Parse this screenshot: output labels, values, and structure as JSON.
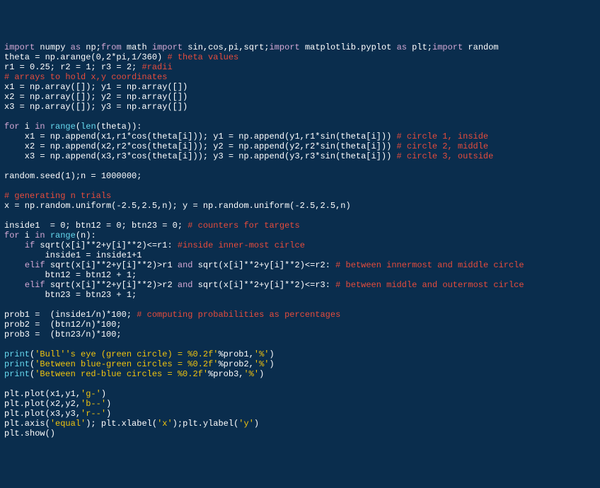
{
  "code": {
    "line1": {
      "import1": "import",
      "numpy": " numpy ",
      "as1": "as",
      "np": " np;",
      "from1": "from",
      "math": " math ",
      "import2": "import",
      "funcs": " sin,cos,pi,sqrt;",
      "import3": "import",
      "mpl": " matplotlib.pyplot ",
      "as2": "as",
      "plt": " plt;",
      "import4": "import",
      "random": " random"
    },
    "line2": {
      "text": "theta = np.arange(0,2*pi,1/360) ",
      "comment": "# theta values"
    },
    "line3": {
      "text": "r1 = 0.25; r2 = 1; r3 = 2; ",
      "comment": "#radii"
    },
    "line4": {
      "comment": "# arrays to hold x,y coordinates"
    },
    "line5": {
      "text": "x1 = np.array([]); y1 = np.array([])"
    },
    "line6": {
      "text": "x2 = np.array([]); y2 = np.array([])"
    },
    "line7": {
      "text": "x3 = np.array([]); y3 = np.array([])"
    },
    "line9": {
      "for": "for",
      "i": " i ",
      "in": "in",
      "range": " range",
      "len": "len",
      "text": "(theta)):"
    },
    "line10": {
      "text": "    x1 = np.append(x1,r1*cos(theta[i])); y1 = np.append(y1,r1*sin(theta[i])) ",
      "comment": "# circle 1, inside"
    },
    "line11": {
      "text": "    x2 = np.append(x2,r2*cos(theta[i])); y2 = np.append(y2,r2*sin(theta[i])) ",
      "comment": "# circle 2, middle"
    },
    "line12": {
      "text": "    x3 = np.append(x3,r3*cos(theta[i])); y3 = np.append(y3,r3*sin(theta[i])) ",
      "comment": "# circle 3, outside"
    },
    "line14": {
      "text": "random.seed(1);n = 1000000;"
    },
    "line16": {
      "comment": "# generating n trials"
    },
    "line17": {
      "text": "x = np.random.uniform(-2.5,2.5,n); y = np.random.uniform(-2.5,2.5,n)"
    },
    "line19": {
      "text": "inside1  = 0; btn12 = 0; btn23 = 0; ",
      "comment": "# counters for targets"
    },
    "line20": {
      "for": "for",
      "i": " i ",
      "in": "in",
      "range": " range",
      "text": "(n):"
    },
    "line21": {
      "indent": "    ",
      "if": "if",
      "sqrt": " sqrt",
      "text": "(x[i]**2+y[i]**2)<=r1: ",
      "comment": "#inside inner-most cirlce"
    },
    "line22": {
      "text": "        inside1 = inside1+1"
    },
    "line23": {
      "indent": "    ",
      "elif": "elif",
      "sqrt1": " sqrt",
      "text1": "(x[i]**2+y[i]**2)>r1 ",
      "and": "and",
      "sqrt2": " sqrt",
      "text2": "(x[i]**2+y[i]**2)<=r2: ",
      "comment": "# between innermost and middle circle"
    },
    "line24": {
      "text": "        btn12 = btn12 + 1;"
    },
    "line25": {
      "indent": "    ",
      "elif": "elif",
      "sqrt1": " sqrt",
      "text1": "(x[i]**2+y[i]**2)>r2 ",
      "and": "and",
      "sqrt2": " sqrt",
      "text2": "(x[i]**2+y[i]**2)<=r3: ",
      "comment": "# between middle and outermost cirlce"
    },
    "line26": {
      "text": "        btn23 = btn23 + 1;"
    },
    "line28": {
      "text": "prob1 =  (inside1/n)*100; ",
      "comment": "# computing probabilities as percentages"
    },
    "line29": {
      "text": "prob2 =  (btn12/n)*100;"
    },
    "line30": {
      "text": "prob3 =  (btn23/n)*100;"
    },
    "line32": {
      "print": "print",
      "paren1": "(",
      "str1": "'Bull'",
      "str2": "'s eye (green circle) = %0.2f'",
      "mid": "%prob1,",
      "str3": "'%'",
      "paren2": ")"
    },
    "line33": {
      "print": "print",
      "paren1": "(",
      "str1": "'Between blue-green circles = %0.2f'",
      "mid": "%prob2,",
      "str2": "'%'",
      "paren2": ")"
    },
    "line34": {
      "print": "print",
      "paren1": "(",
      "str1": "'Between red-blue circles = %0.2f'",
      "mid": "%prob3,",
      "str2": "'%'",
      "paren2": ")"
    },
    "line36": {
      "text1": "plt.plot(x1,y1,",
      "str": "'g-'",
      "text2": ")"
    },
    "line37": {
      "text1": "plt.plot(x2,y2,",
      "str": "'b--'",
      "text2": ")"
    },
    "line38": {
      "text1": "plt.plot(x3,y3,",
      "str": "'r--'",
      "text2": ")"
    },
    "line39": {
      "text1": "plt.axis(",
      "str1": "'equal'",
      "text2": "); plt.xlabel(",
      "str2": "'x'",
      "text3": ");plt.ylabel(",
      "str3": "'y'",
      "text4": ")"
    },
    "line40": {
      "text": "plt.show()"
    }
  }
}
